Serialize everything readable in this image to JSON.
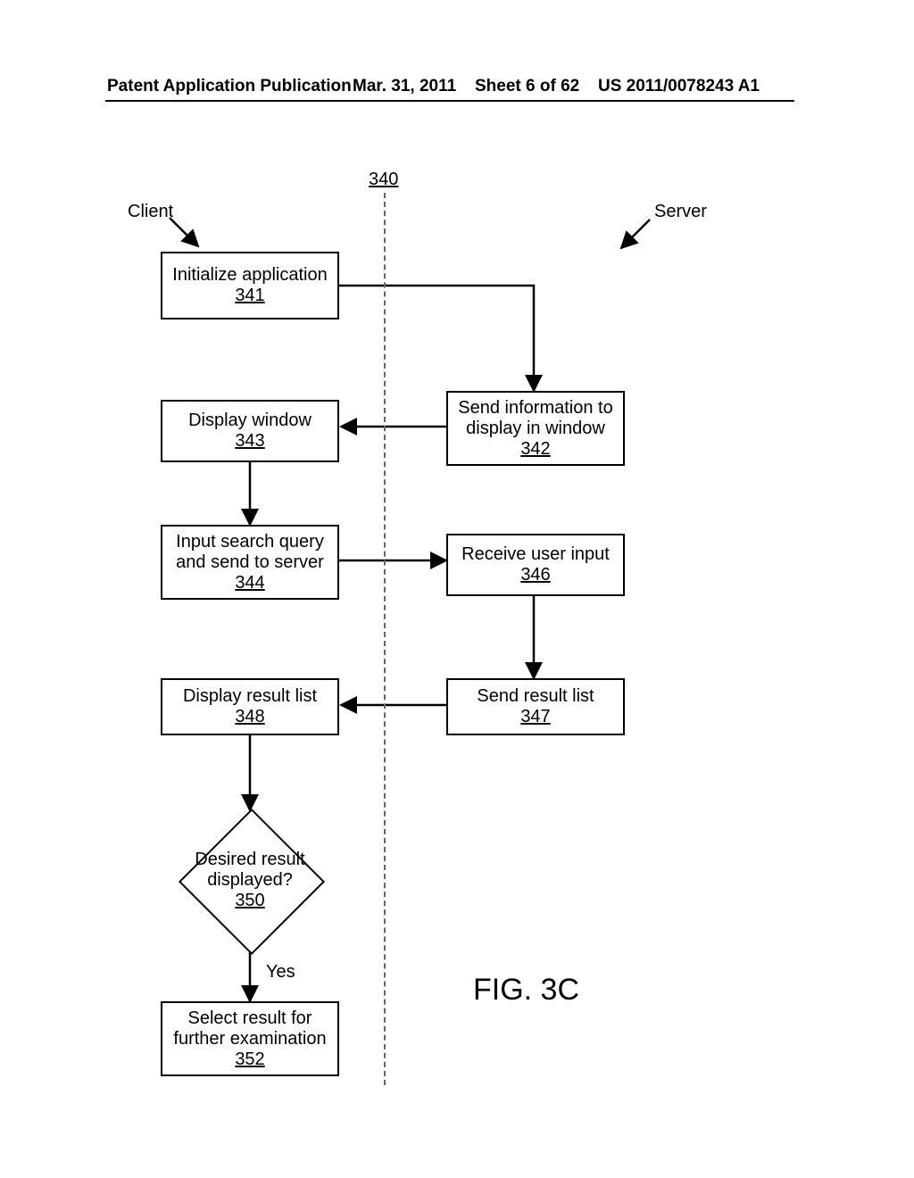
{
  "header": {
    "publication_type": "Patent Application Publication",
    "date": "Mar. 31, 2011",
    "sheet": "Sheet 6 of 62",
    "pub_no": "US 2011/0078243 A1"
  },
  "diagram_number_ref": "340",
  "client_label": "Client",
  "server_label": "Server",
  "boxes": {
    "init": {
      "title": "Initialize application",
      "ref": "341"
    },
    "sendinfo": {
      "title_l1": "Send information to",
      "title_l2": "display in window",
      "ref": "342"
    },
    "dispwin": {
      "title": "Display window",
      "ref": "343"
    },
    "inputq": {
      "title_l1": "Input search query",
      "title_l2": "and send to server",
      "ref": "344"
    },
    "recvinput": {
      "title": "Receive user input",
      "ref": "346"
    },
    "sendlist": {
      "title": "Send result list",
      "ref": "347"
    },
    "displist": {
      "title": "Display result list",
      "ref": "348"
    },
    "decision": {
      "title_l1": "Desired result",
      "title_l2": "displayed?",
      "ref": "350"
    },
    "yes_label": "Yes",
    "select": {
      "title_l1": "Select result for",
      "title_l2": "further examination",
      "ref": "352"
    }
  },
  "figure_label": "FIG. 3C"
}
